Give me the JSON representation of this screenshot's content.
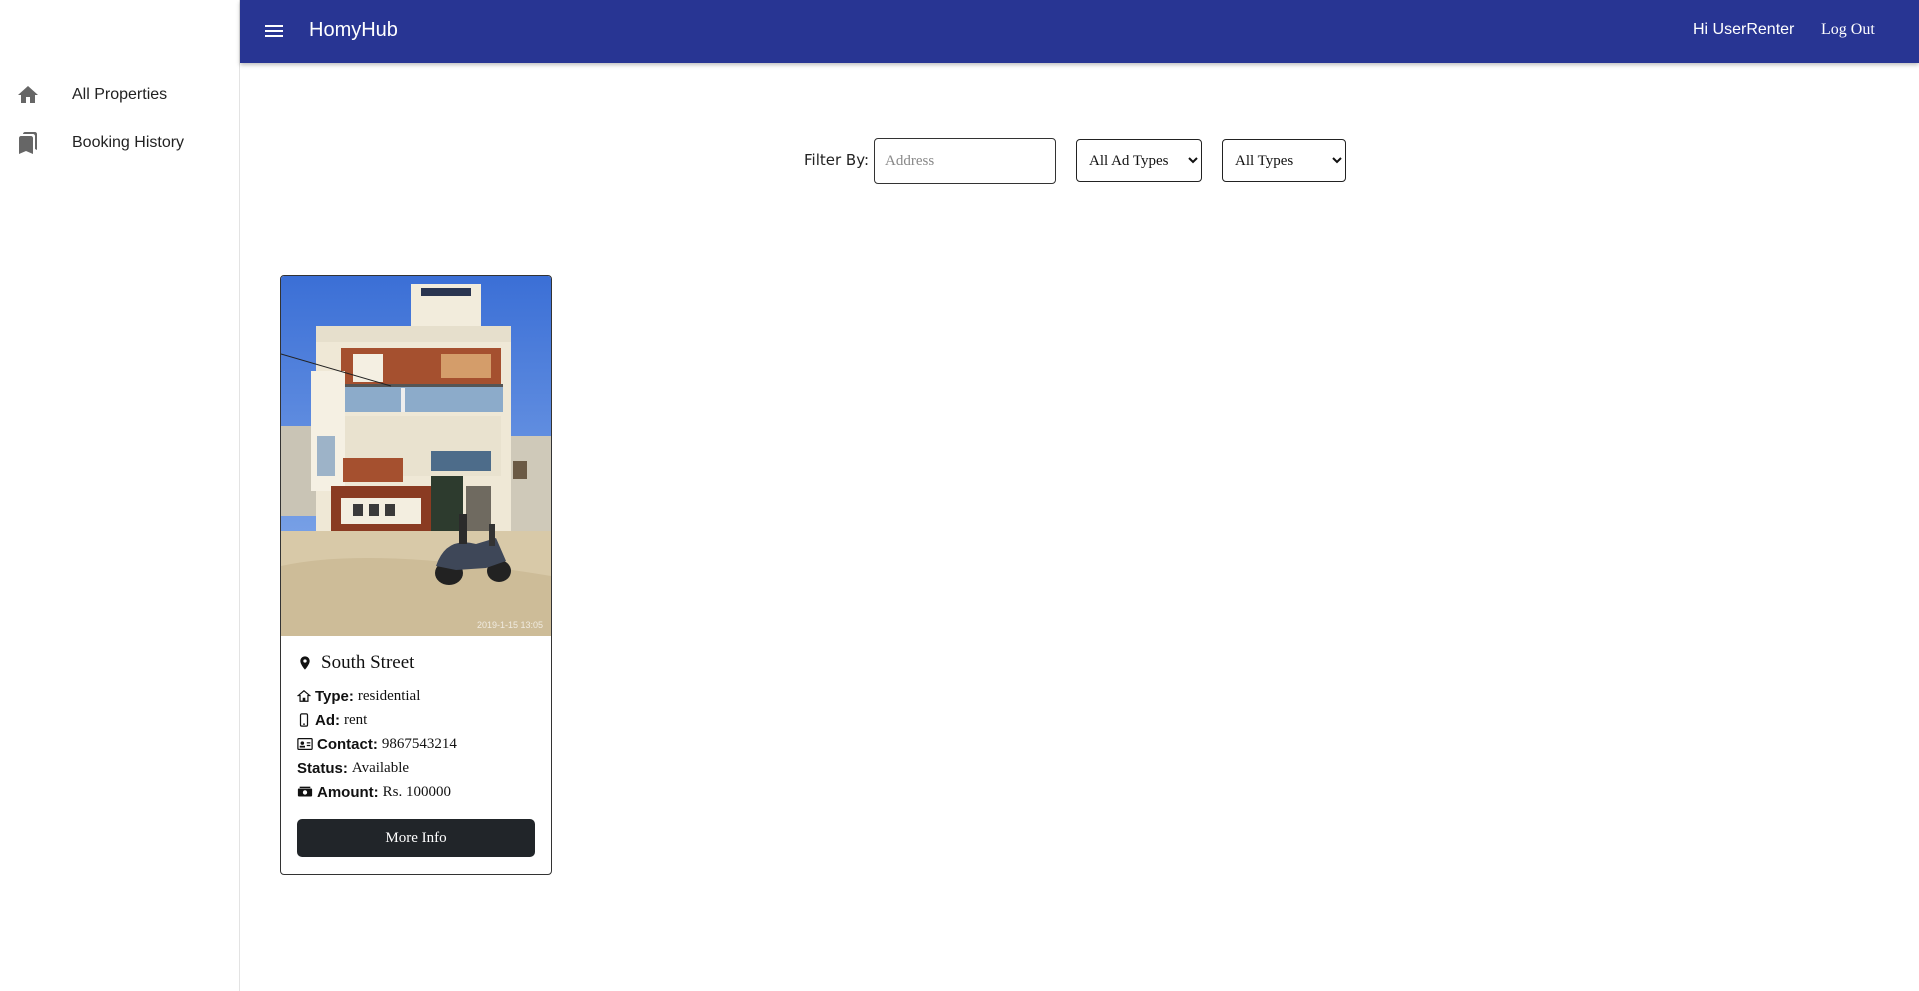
{
  "app": {
    "title": "HomyHub",
    "greeting": "Hi UserRenter",
    "logout_label": "Log Out",
    "bar_color": "#283593"
  },
  "sidebar": {
    "items": [
      {
        "label": "All Properties",
        "icon": "home-icon"
      },
      {
        "label": "Booking History",
        "icon": "bookmarks-icon"
      }
    ]
  },
  "filter": {
    "label": "Filter By:",
    "address_placeholder": "Address",
    "ad_type_selected": "All Ad Types",
    "type_selected": "All Types"
  },
  "properties": [
    {
      "address": "South Street",
      "type_label": "Type:",
      "type": "residential",
      "ad_label": "Ad:",
      "ad": "rent",
      "contact_label": "Contact:",
      "contact": "9867543214",
      "status_label": "Status:",
      "status": "Available",
      "amount_label": "Amount:",
      "amount": "Rs. 100000",
      "button_label": "More Info",
      "photo_timestamp": "2019-1-15 13:05"
    }
  ]
}
